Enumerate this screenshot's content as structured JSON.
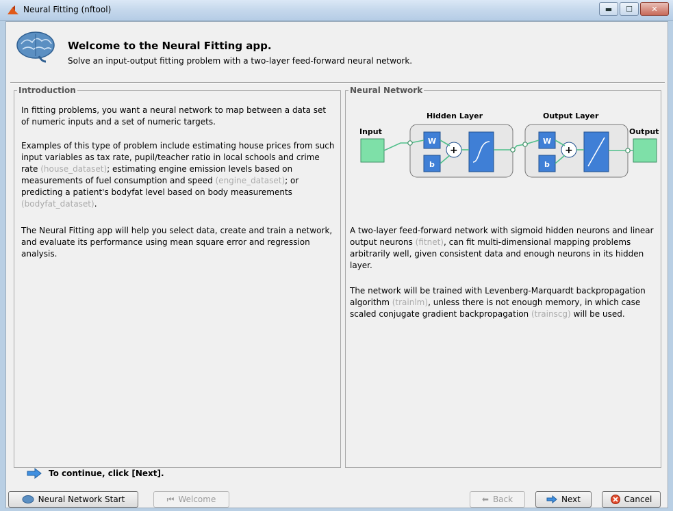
{
  "window": {
    "title": "Neural Fitting (nftool)",
    "minimize_glyph": "▬",
    "maximize_glyph": "☐",
    "close_glyph": "✕"
  },
  "header": {
    "title": "Welcome to the Neural Fitting app.",
    "subtitle": "Solve an input-output fitting problem with a two-layer feed-forward neural network."
  },
  "intro": {
    "title": "Introduction",
    "p1": "In fitting problems, you want a neural network to map between a data set of numeric inputs and a set of numeric targets.",
    "p2_a": "Examples of this type of problem include estimating house prices from such input variables as tax rate, pupil/teacher ratio in local schools and crime rate ",
    "p2_link1": "(house_dataset)",
    "p2_b": "; estimating engine emission levels based on measurements of fuel consumption and speed ",
    "p2_link2": "(engine_dataset)",
    "p2_c": "; or predicting a patient's bodyfat level based on body measurements ",
    "p2_link3": "(bodyfat_dataset)",
    "p2_d": ".",
    "p3": "The Neural Fitting app will help you select data, create and train a network, and evaluate its performance using mean square error and regression analysis."
  },
  "network": {
    "title": "Neural Network",
    "diagram": {
      "input_label": "Input",
      "output_label": "Output",
      "hidden_label": "Hidden Layer",
      "output_layer_label": "Output Layer",
      "w": "W",
      "b": "b",
      "plus": "+"
    },
    "p1_a": "A two-layer feed-forward network with sigmoid hidden neurons and linear output neurons ",
    "p1_link": "(fitnet)",
    "p1_b": ", can fit multi-dimensional mapping problems arbitrarily well, given consistent data and enough neurons in its hidden layer.",
    "p2_a": "The network will be trained with Levenberg-Marquardt backpropagation algorithm ",
    "p2_link1": "(trainlm)",
    "p2_b": ", unless there is not enough memory, in which case scaled conjugate gradient backpropagation ",
    "p2_link2": "(trainscg)",
    "p2_c": " will be used."
  },
  "footer": {
    "continue_text": "To continue, click [Next].",
    "buttons": {
      "nn_start": "Neural Network Start",
      "welcome": "Welcome",
      "back": "Back",
      "next": "Next",
      "cancel": "Cancel"
    }
  },
  "colors": {
    "link": "#aaaaaa",
    "node": "#7ee0a8",
    "weight": "#3f7fd6",
    "arrow": "#4fbf8a"
  }
}
